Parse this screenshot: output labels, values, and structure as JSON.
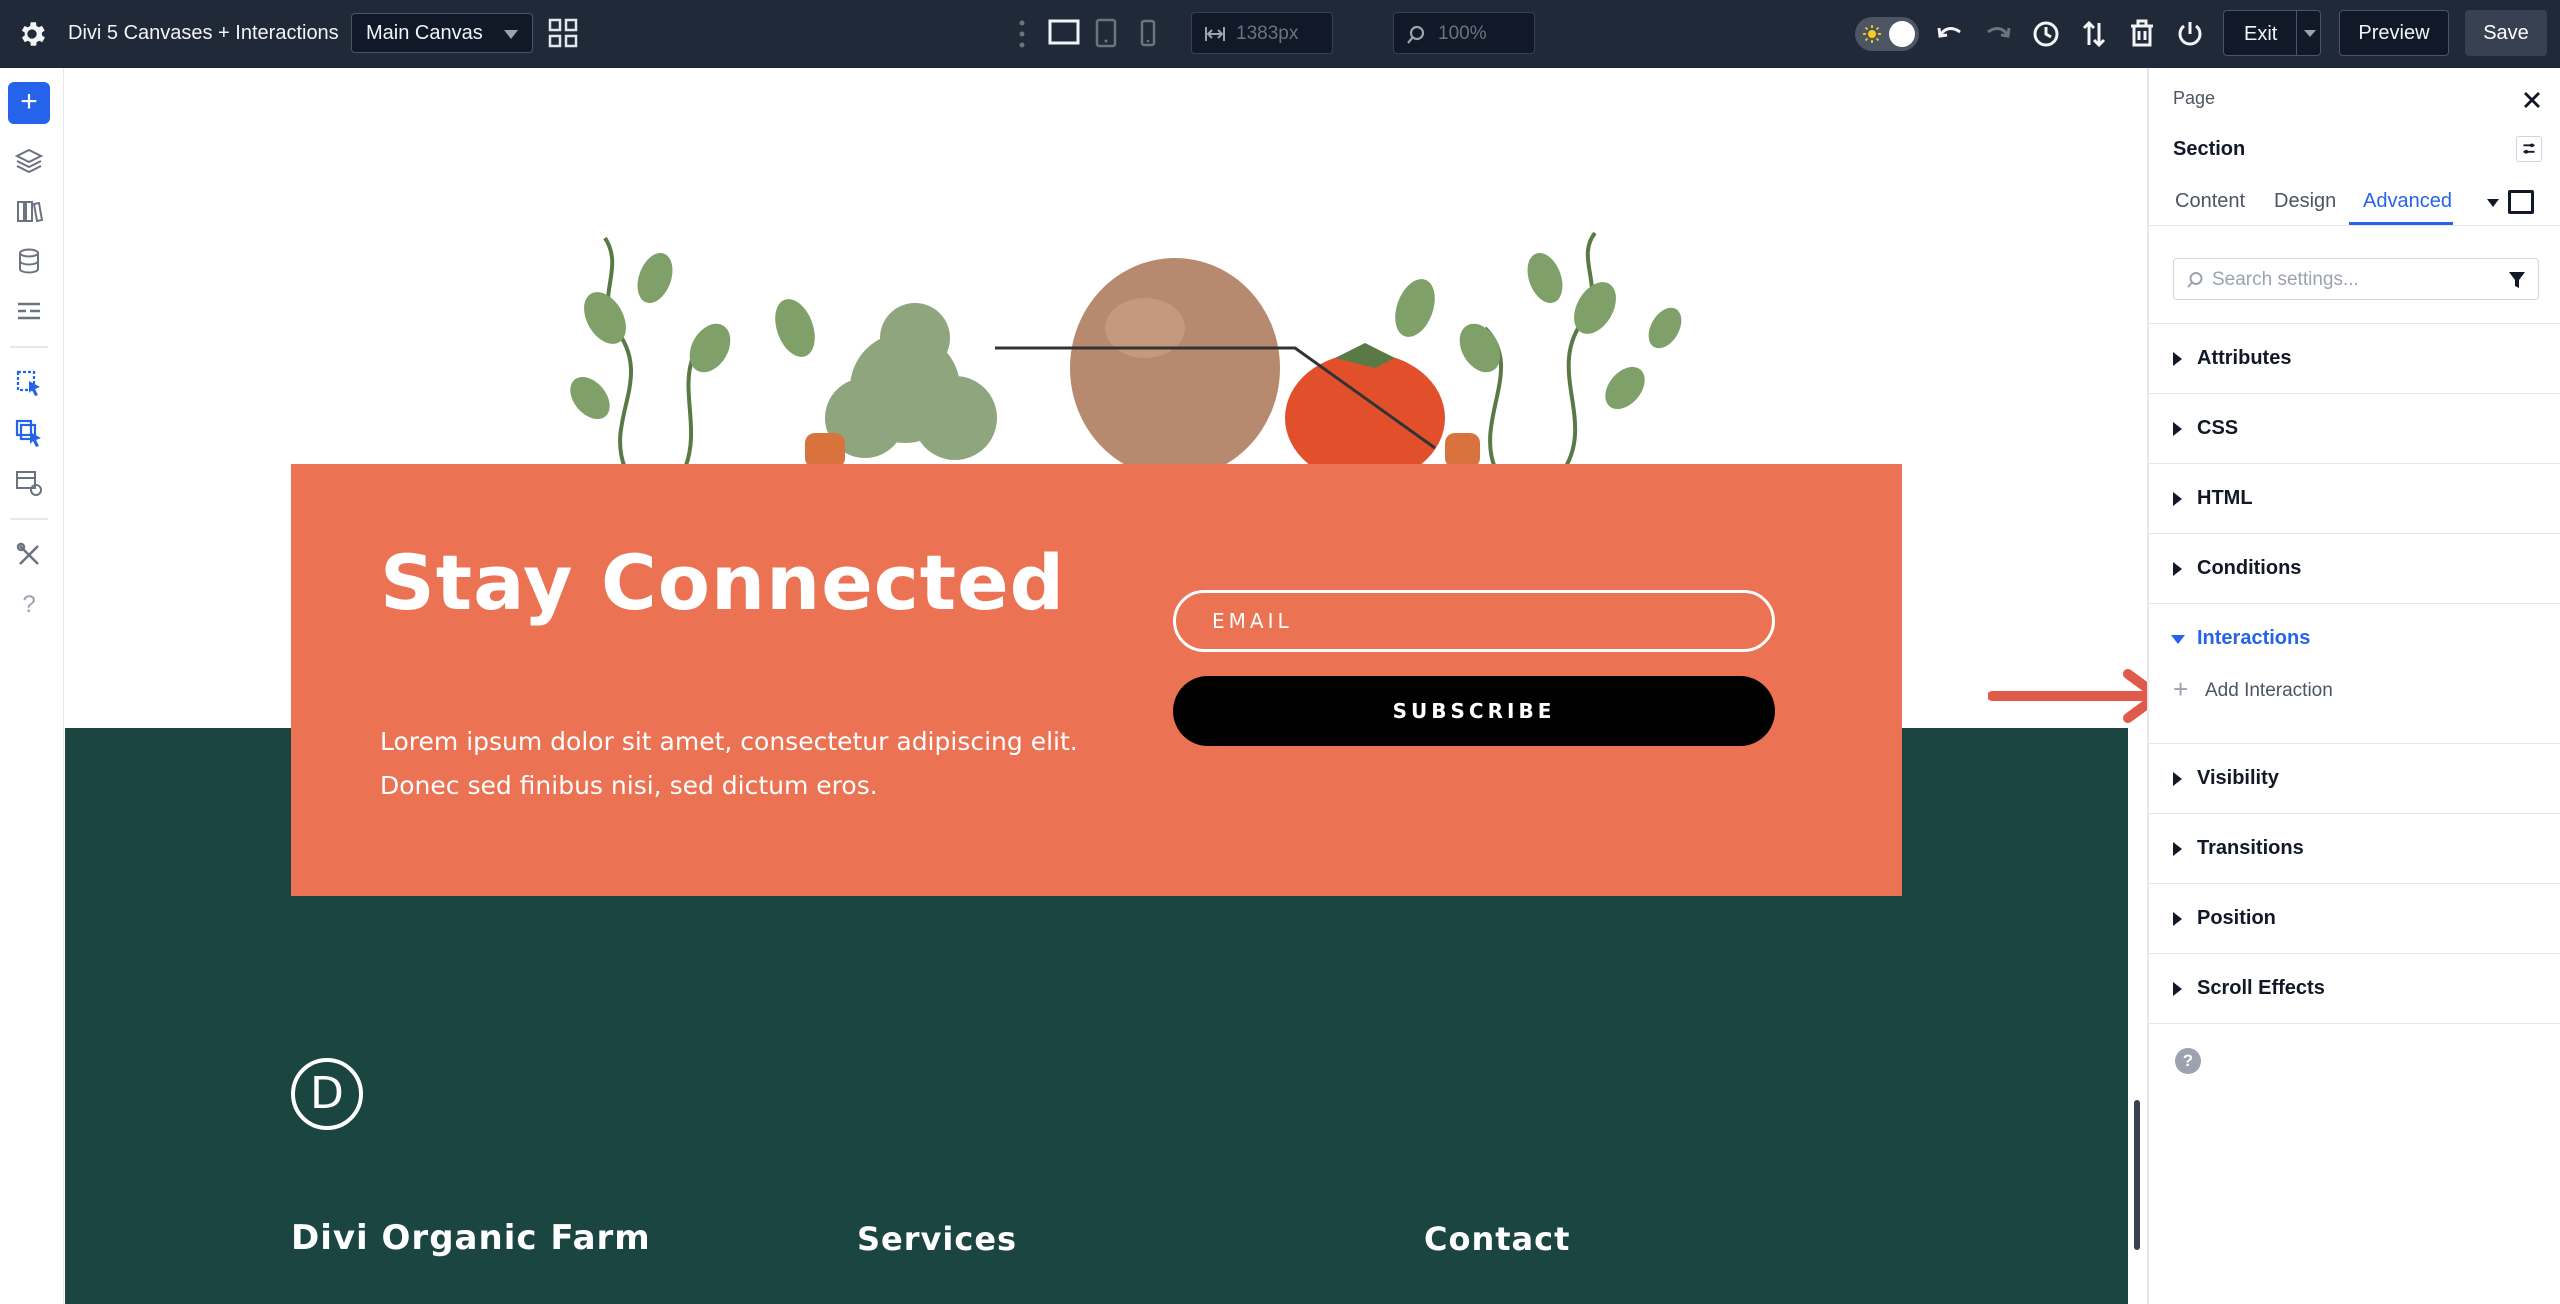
{
  "topbar": {
    "title": "Divi 5 Canvases + Interactions",
    "canvas_select": "Main Canvas",
    "width_value": "1383px",
    "zoom_value": "100%",
    "exit_label": "Exit",
    "preview_label": "Preview",
    "save_label": "Save",
    "icons": [
      "gear-icon",
      "grid-icon",
      "kebab-icon",
      "desktop-icon",
      "tablet-icon",
      "phone-icon",
      "width-icon",
      "zoom-icon",
      "theme-toggle",
      "undo-icon",
      "redo-icon",
      "history-icon",
      "sort-icon",
      "trash-icon",
      "power-icon"
    ]
  },
  "sidebar": {
    "icons": [
      "add-icon",
      "layers-icon",
      "library-icon",
      "database-icon",
      "layout-icon",
      "canvas-pointer-icon",
      "canvas-stack-icon",
      "canvas-settings-icon",
      "tools-icon",
      "help-icon"
    ]
  },
  "canvas": {
    "hero_title": "Stay Connected",
    "hero_text": "Lorem ipsum dolor sit amet, consectetur adipiscing elit. Donec sed finibus nisi, sed dictum eros.",
    "email_placeholder": "EMAIL",
    "subscribe_label": "SUBSCRIBE",
    "logo_letter": "D",
    "footer_brand": "Divi Organic Farm",
    "footer_services": "Services",
    "footer_contact": "Contact",
    "colors": {
      "orange": "#ec7254",
      "green": "#1b4540"
    }
  },
  "panel": {
    "breadcrumb": "Page",
    "element": "Section",
    "tabs": [
      {
        "label": "Content"
      },
      {
        "label": "Design"
      },
      {
        "label": "Advanced",
        "active": true
      }
    ],
    "search_placeholder": "Search settings...",
    "accordions": [
      {
        "label": "Attributes"
      },
      {
        "label": "CSS"
      },
      {
        "label": "HTML"
      },
      {
        "label": "Conditions"
      },
      {
        "label": "Interactions",
        "open": true
      },
      {
        "label": "Visibility"
      },
      {
        "label": "Transitions"
      },
      {
        "label": "Position"
      },
      {
        "label": "Scroll Effects"
      }
    ],
    "add_interaction_label": "Add Interaction",
    "help_glyph": "?",
    "accent": "#2563eb"
  }
}
